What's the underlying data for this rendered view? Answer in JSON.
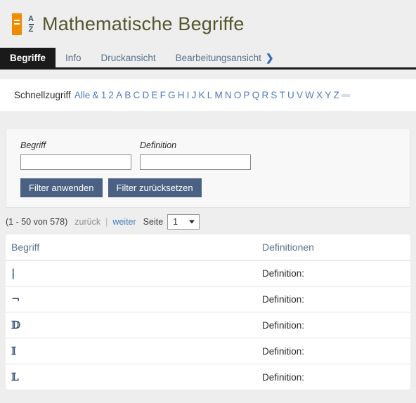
{
  "header": {
    "title": "Mathematische Begriffe",
    "logo_icon": "az-book-icon",
    "logo_letters": {
      "top": "A",
      "bottom": "Z"
    }
  },
  "tabs": [
    {
      "label": "Begriffe",
      "active": true
    },
    {
      "label": "Info",
      "active": false
    },
    {
      "label": "Druckansicht",
      "active": false
    },
    {
      "label": "Bearbeitungsansicht",
      "active": false,
      "chevron": "❯"
    }
  ],
  "quickaccess": {
    "label": "Schnellzugriff",
    "links": [
      "Alle",
      "&",
      "1",
      "2",
      "A",
      "B",
      "C",
      "D",
      "E",
      "F",
      "G",
      "H",
      "I",
      "J",
      "K",
      "L",
      "M",
      "N",
      "O",
      "P",
      "Q",
      "R",
      "S",
      "T",
      "U",
      "V",
      "W",
      "X",
      "Y",
      "Z"
    ],
    "current": ""
  },
  "filter": {
    "term_label": "Begriff",
    "term_value": "",
    "term_placeholder": "",
    "definition_label": "Definition",
    "definition_value": "",
    "definition_placeholder": "",
    "apply_label": "Filter anwenden",
    "reset_label": "Filter zurücksetzen"
  },
  "pager": {
    "count": "(1 - 50 von 578)",
    "prev": "zurück",
    "separator": "|",
    "next": "weiter",
    "page_label": "Seite",
    "page_value": "1"
  },
  "table": {
    "columns": [
      "Begriff",
      "Definitionen"
    ],
    "rows": [
      {
        "term": "|",
        "definition": "Definition:"
      },
      {
        "term": "¬",
        "definition": "Definition:"
      },
      {
        "term": "𝔻",
        "definition": "Definition:"
      },
      {
        "term": "𝕀",
        "definition": "Definition:"
      },
      {
        "term": "𝕃",
        "definition": "Definition:"
      }
    ]
  },
  "colors": {
    "title": "#55552e",
    "accent_orange": "#f08c00",
    "link_blue": "#4a7bbd",
    "button_blue": "#4a6184",
    "active_tab": "#1a1a1a",
    "page_bg": "#eeeeee"
  }
}
